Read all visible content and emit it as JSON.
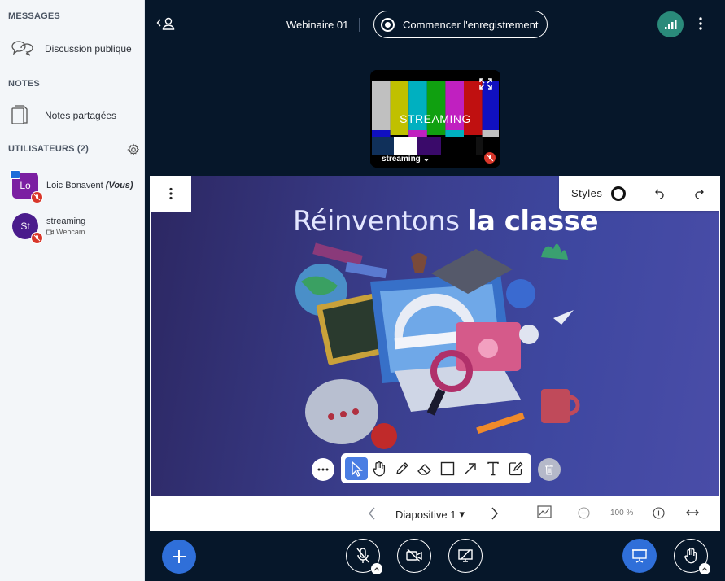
{
  "sidebar": {
    "messages_title": "MESSAGES",
    "public_chat": "Discussion publique",
    "notes_title": "NOTES",
    "shared_notes": "Notes partagées",
    "users_title": "UTILISATEURS (2)",
    "users": [
      {
        "initials": "Lo",
        "name": "Loic Bonavent",
        "suffix": "(Vous)",
        "sub": ""
      },
      {
        "initials": "St",
        "name": "streaming",
        "suffix": "",
        "sub": "Webcam"
      }
    ]
  },
  "topbar": {
    "meeting_title": "Webinaire 01",
    "record_label": "Commencer l'enregistrement"
  },
  "webcam": {
    "overlay_text": "STREAMING",
    "name": "streaming"
  },
  "slide": {
    "title_light": "Réinventons ",
    "title_bold": "la classe"
  },
  "whiteboard": {
    "styles_label": "Styles"
  },
  "slide_nav": {
    "current": "Diapositive 1",
    "zoom": "100 %"
  },
  "colors": {
    "accent": "#2f6fd9",
    "background": "#06172a",
    "connection": "#2a8a7a",
    "mute": "#d8362a",
    "avatar_lo": "#7b1fa2",
    "avatar_st": "#4a1c8c"
  }
}
